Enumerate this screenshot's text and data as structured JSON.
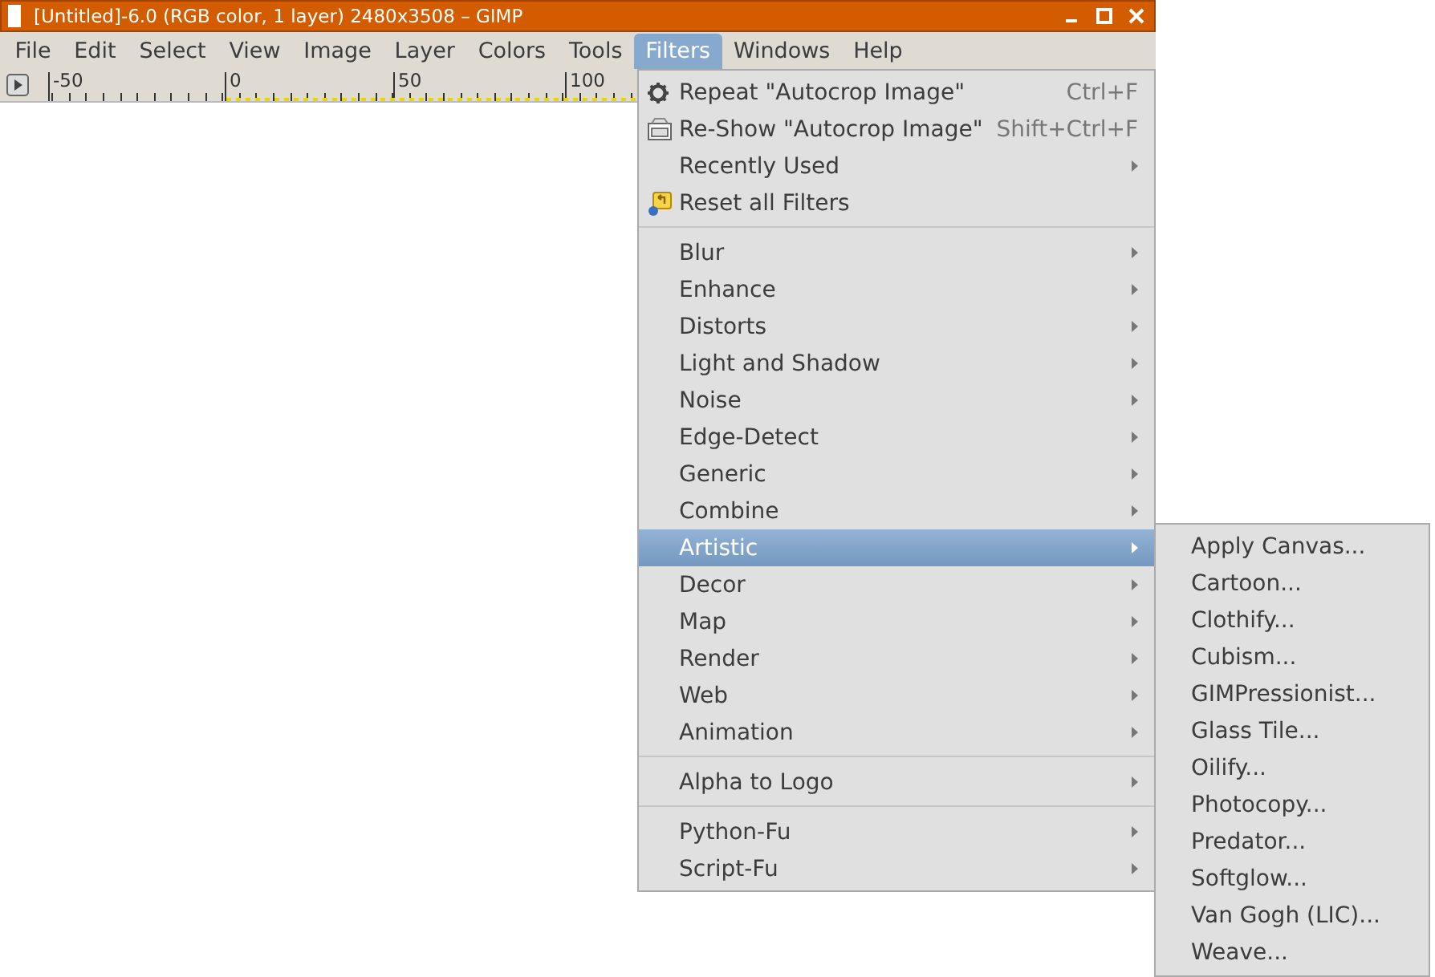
{
  "window": {
    "title": "[Untitled]-6.0 (RGB color, 1 layer) 2480x3508 – GIMP"
  },
  "menubar": [
    {
      "label": "File",
      "selected": false
    },
    {
      "label": "Edit",
      "selected": false
    },
    {
      "label": "Select",
      "selected": false
    },
    {
      "label": "View",
      "selected": false
    },
    {
      "label": "Image",
      "selected": false
    },
    {
      "label": "Layer",
      "selected": false
    },
    {
      "label": "Colors",
      "selected": false
    },
    {
      "label": "Tools",
      "selected": false
    },
    {
      "label": "Filters",
      "selected": true
    },
    {
      "label": "Windows",
      "selected": false
    },
    {
      "label": "Help",
      "selected": false
    }
  ],
  "ruler": {
    "labels": [
      "-50",
      "0",
      "50",
      "100"
    ]
  },
  "filters_menu": {
    "sections": [
      [
        {
          "kind": "gear",
          "label": "Repeat \"Autocrop Image\"",
          "shortcut": "Ctrl+F",
          "submenu": false,
          "selected": false
        },
        {
          "kind": "reshow",
          "label": "Re-Show \"Autocrop Image\"",
          "shortcut": "Shift+Ctrl+F",
          "submenu": false,
          "selected": false
        },
        {
          "kind": "plain",
          "label": "Recently Used",
          "submenu": true,
          "selected": false
        },
        {
          "kind": "reset",
          "label": "Reset all Filters",
          "submenu": false,
          "selected": false
        }
      ],
      [
        {
          "kind": "plain",
          "label": "Blur",
          "submenu": true,
          "selected": false
        },
        {
          "kind": "plain",
          "label": "Enhance",
          "submenu": true,
          "selected": false
        },
        {
          "kind": "plain",
          "label": "Distorts",
          "submenu": true,
          "selected": false
        },
        {
          "kind": "plain",
          "label": "Light and Shadow",
          "submenu": true,
          "selected": false
        },
        {
          "kind": "plain",
          "label": "Noise",
          "submenu": true,
          "selected": false
        },
        {
          "kind": "plain",
          "label": "Edge-Detect",
          "submenu": true,
          "selected": false
        },
        {
          "kind": "plain",
          "label": "Generic",
          "submenu": true,
          "selected": false
        },
        {
          "kind": "plain",
          "label": "Combine",
          "submenu": true,
          "selected": false
        },
        {
          "kind": "plain",
          "label": "Artistic",
          "submenu": true,
          "selected": true
        },
        {
          "kind": "plain",
          "label": "Decor",
          "submenu": true,
          "selected": false
        },
        {
          "kind": "plain",
          "label": "Map",
          "submenu": true,
          "selected": false
        },
        {
          "kind": "plain",
          "label": "Render",
          "submenu": true,
          "selected": false
        },
        {
          "kind": "plain",
          "label": "Web",
          "submenu": true,
          "selected": false
        },
        {
          "kind": "plain",
          "label": "Animation",
          "submenu": true,
          "selected": false
        }
      ],
      [
        {
          "kind": "plain",
          "label": "Alpha to Logo",
          "submenu": true,
          "selected": false
        }
      ],
      [
        {
          "kind": "plain",
          "label": "Python-Fu",
          "submenu": true,
          "selected": false
        },
        {
          "kind": "plain",
          "label": "Script-Fu",
          "submenu": true,
          "selected": false
        }
      ]
    ]
  },
  "artistic_submenu": [
    "Apply Canvas...",
    "Cartoon...",
    "Clothify...",
    "Cubism...",
    "GIMPressionist...",
    "Glass Tile...",
    "Oilify...",
    "Photocopy...",
    "Predator...",
    "Softglow...",
    "Van Gogh (LIC)...",
    "Weave..."
  ]
}
